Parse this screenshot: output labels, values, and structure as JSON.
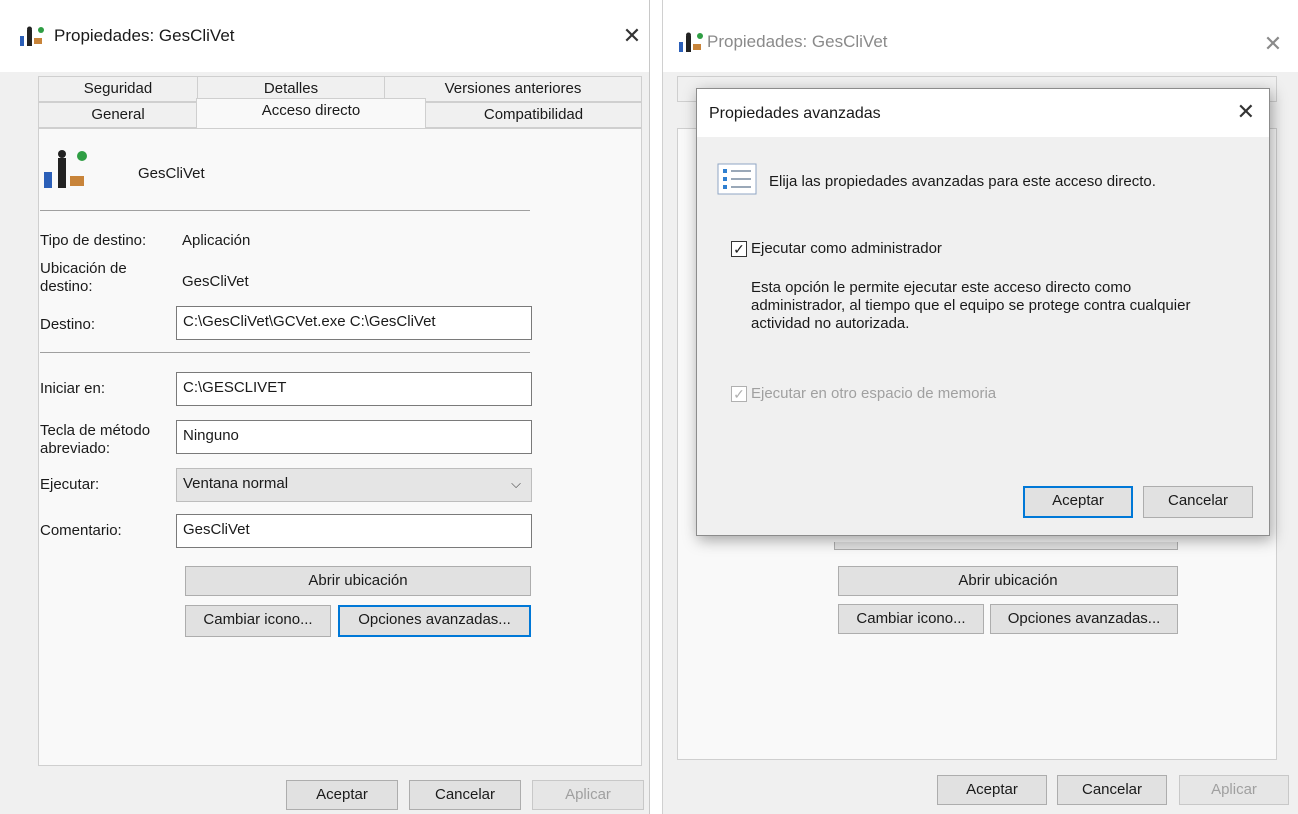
{
  "left_window": {
    "title": "Propiedades: GesCliVet",
    "tabs_row1": [
      "Seguridad",
      "Detalles",
      "Versiones anteriores"
    ],
    "tabs_row2": [
      "General",
      "Acceso directo",
      "Compatibilidad"
    ],
    "app_name": "GesCliVet",
    "tipo_destino_label": "Tipo de destino:",
    "tipo_destino_value": "Aplicación",
    "ubicacion_label_1": "Ubicación de",
    "ubicacion_label_2": "destino:",
    "ubicacion_value": "GesCliVet",
    "destino_label": "Destino:",
    "destino_value": "C:\\GesCliVet\\GCVet.exe C:\\GesCliVet",
    "iniciar_label": "Iniciar en:",
    "iniciar_value": "C:\\GESCLIVET",
    "tecla_label_1": "Tecla de método",
    "tecla_label_2": "abreviado:",
    "tecla_value": "Ninguno",
    "ejecutar_label": "Ejecutar:",
    "ejecutar_value": "Ventana normal",
    "comentario_label": "Comentario:",
    "comentario_value": "GesCliVet",
    "abrir_ubicacion": "Abrir ubicación",
    "cambiar_icono": "Cambiar icono...",
    "opciones_avanzadas": "Opciones avanzadas...",
    "aceptar": "Aceptar",
    "cancelar": "Cancelar",
    "aplicar": "Aplicar"
  },
  "right_window": {
    "title": "Propiedades: GesCliVet",
    "abrir_ubicacion": "Abrir ubicación",
    "cambiar_icono": "Cambiar icono...",
    "opciones_avanzadas": "Opciones avanzadas...",
    "aceptar": "Aceptar",
    "cancelar": "Cancelar",
    "aplicar": "Aplicar"
  },
  "dialog": {
    "title": "Propiedades avanzadas",
    "intro": "Elija las propiedades avanzadas para este acceso directo.",
    "run_as_admin_label": "Ejecutar como administrador",
    "description_1": "Esta opción le permite ejecutar este acceso directo como",
    "description_2": "administrador, al tiempo que el equipo se protege contra cualquier",
    "description_3": "actividad no autorizada.",
    "separate_memory_label": "Ejecutar en otro espacio de memoria",
    "aceptar": "Aceptar",
    "cancelar": "Cancelar",
    "check_glyph": "✓"
  },
  "icons": {
    "close": "✕",
    "chevron_down": "⌵"
  },
  "colors": {
    "accent": "#0078d7",
    "window_bg": "#f0f0f0",
    "panel_bg": "#f9f9f9"
  }
}
